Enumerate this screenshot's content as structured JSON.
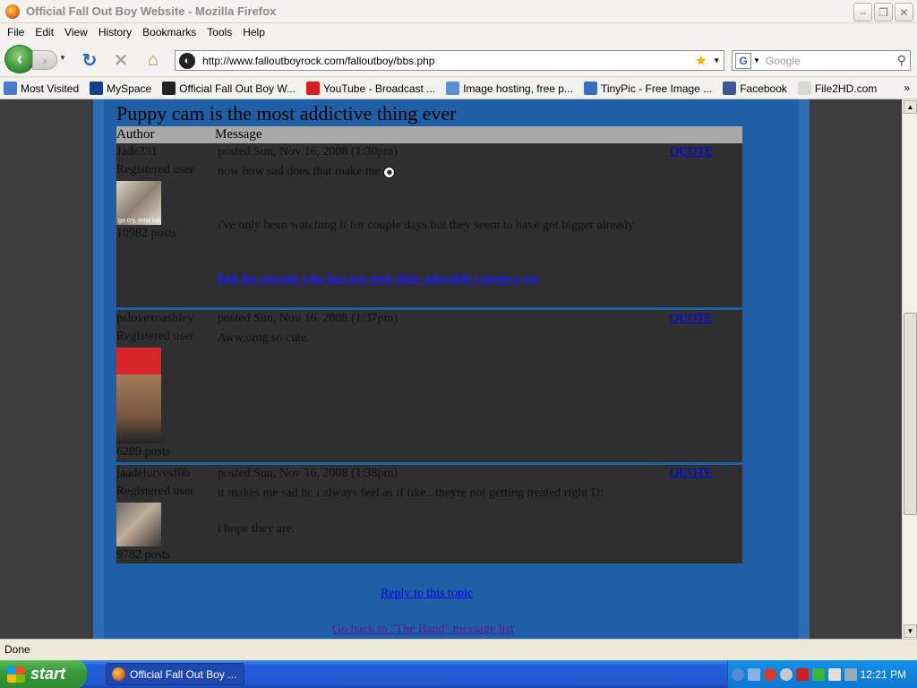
{
  "window": {
    "title": "Official Fall Out Boy Website - Mozilla Firefox"
  },
  "menu": [
    "File",
    "Edit",
    "View",
    "History",
    "Bookmarks",
    "Tools",
    "Help"
  ],
  "nav": {
    "url": "http://www.falloutboyrock.com/falloutboy/bbs.php",
    "search_placeholder": "Google"
  },
  "bookmarks": [
    {
      "label": "Most Visited",
      "color": "#4a7bd0"
    },
    {
      "label": "MySpace",
      "color": "#1c3f8a"
    },
    {
      "label": "Official Fall Out Boy W...",
      "color": "#222222"
    },
    {
      "label": "YouTube - Broadcast ...",
      "color": "#d62020"
    },
    {
      "label": "Image hosting, free p...",
      "color": "#5a8fd8"
    },
    {
      "label": "TinyPic - Free Image ...",
      "color": "#3a6cc4"
    },
    {
      "label": "Facebook",
      "color": "#3b5998"
    },
    {
      "label": "File2HD.com",
      "color": "#d9d9d9"
    }
  ],
  "forum": {
    "topic": "Puppy cam is the most addictive thing ever",
    "col_author": "Author",
    "col_message": "Message",
    "posts": [
      {
        "author": "Jade331",
        "role": "Registered user",
        "count": "10982 posts",
        "meta": "posted Sun, Nov 16, 2008 (1:30pm)",
        "quote": "QUOTE",
        "avatar_caption": "go cry, emo kid",
        "line1": "now how sad does that make me",
        "line2": "i've only been watching it for couple days but they seem to have got bigger already",
        "link": "link for anyone who has not seen their adorable cuteness yet"
      },
      {
        "author": "pslovexoashley",
        "role": "Registered user",
        "count": "6289 posts",
        "meta": "posted Sun, Nov 16, 2008 (1:37pm)",
        "quote": "QUOTE",
        "line1": "Aww,omg so cute."
      },
      {
        "author": "jaadelurvesf0b",
        "role": "Registered user",
        "count": "9782 posts",
        "meta": "posted Sun, Nov 16, 2008 (1:38pm)",
        "quote": "QUOTE",
        "line1": "it makes me sad bc i always feel as if like...theyre not getting treated right D:",
        "line2": "i hope they are."
      }
    ],
    "reply": "Reply to this topic",
    "goback": "Go back to \"The Band\" message list"
  },
  "status": "Done",
  "taskbar": {
    "start": "start",
    "item": "Official Fall Out Boy ...",
    "clock": "12:21 PM"
  }
}
